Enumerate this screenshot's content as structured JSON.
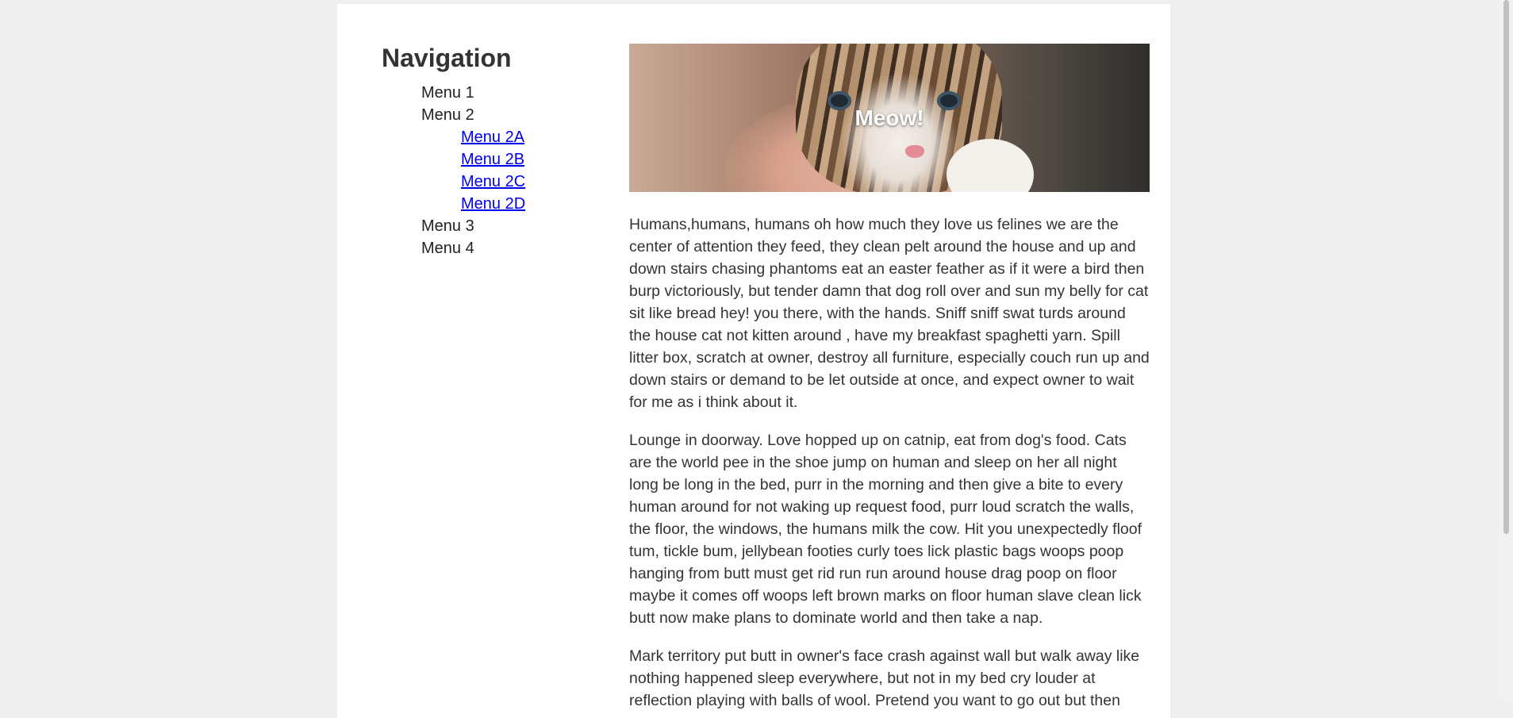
{
  "sidebar": {
    "title": "Navigation",
    "menu": [
      {
        "label": "Menu 1"
      },
      {
        "label": "Menu 2",
        "children": [
          {
            "label": "Menu 2A"
          },
          {
            "label": "Menu 2B"
          },
          {
            "label": "Menu 2C"
          },
          {
            "label": "Menu 2D"
          }
        ]
      },
      {
        "label": "Menu 3"
      },
      {
        "label": "Menu 4"
      }
    ]
  },
  "hero": {
    "title": "Meow!"
  },
  "paragraphs": [
    "Humans,humans, humans oh how much they love us felines we are the center of attention they feed, they clean pelt around the house and up and down stairs chasing phantoms eat an easter feather as if it were a bird then burp victoriously, but tender damn that dog roll over and sun my belly for cat sit like bread hey! you there, with the hands. Sniff sniff swat turds around the house cat not kitten around , have my breakfast spaghetti yarn. Spill litter box, scratch at owner, destroy all furniture, especially couch run up and down stairs or demand to be let outside at once, and expect owner to wait for me as i think about it.",
    "Lounge in doorway. Love hopped up on catnip, eat from dog's food. Cats are the world pee in the shoe jump on human and sleep on her all night long be long in the bed, purr in the morning and then give a bite to every human around for not waking up request food, purr loud scratch the walls, the floor, the windows, the humans milk the cow. Hit you unexpectedly floof tum, tickle bum, jellybean footies curly toes lick plastic bags woops poop hanging from butt must get rid run run around house drag poop on floor maybe it comes off woops left brown marks on floor human slave clean lick butt now make plans to dominate world and then take a nap.",
    "Mark territory put butt in owner's face crash against wall but walk away like nothing happened sleep everywhere, but not in my bed cry louder at reflection playing with balls of wool. Pretend you want to go out but then"
  ],
  "colors": {
    "background": "#efefef",
    "page": "#ffffff",
    "link": "#0000ee",
    "text": "#333333"
  }
}
